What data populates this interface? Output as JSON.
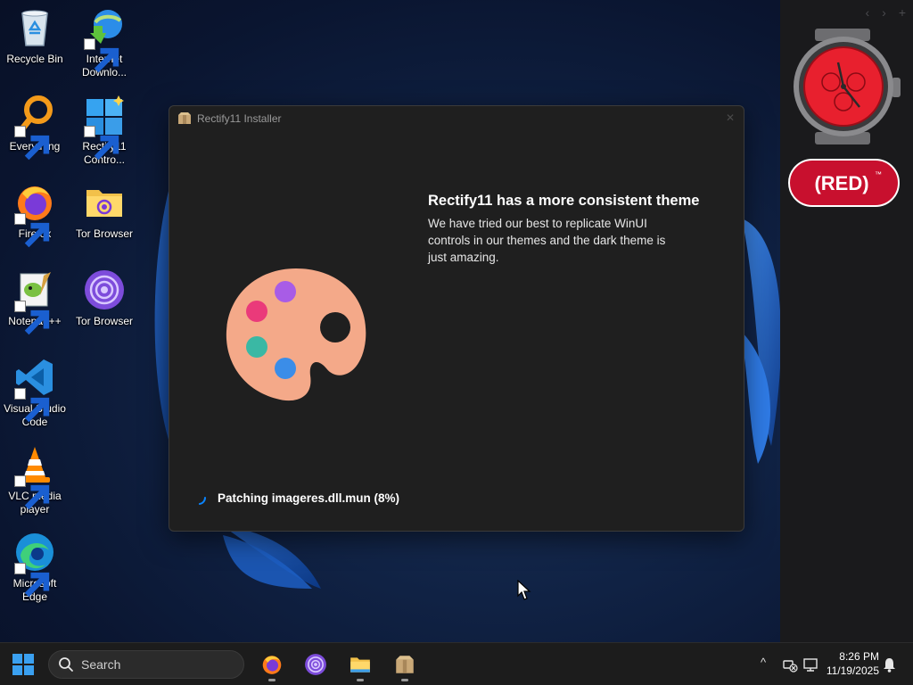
{
  "desktop": {
    "icons": [
      {
        "label": "Recycle Bin"
      },
      {
        "label": "Internet Downlo..."
      },
      {
        "label": "Everything"
      },
      {
        "label": "Rectify11 Contro..."
      },
      {
        "label": "Firefox"
      },
      {
        "label": "Tor Browser"
      },
      {
        "label": "Notepad++"
      },
      {
        "label": "Tor Browser"
      },
      {
        "label": "Visual Studio Code"
      },
      {
        "label": "VLC media player"
      },
      {
        "label": "Microsoft Edge"
      }
    ]
  },
  "side_panel": {
    "nav_back": "‹",
    "nav_forward": "›",
    "nav_add": "+",
    "badge_text": "(RED)",
    "badge_tm": "™"
  },
  "installer": {
    "title": "Rectify11 Installer",
    "close": "✕",
    "heading": "Rectify11 has a more consistent theme",
    "description": "We have tried our best to replicate WinUI controls in our themes and the dark theme is just amazing.",
    "progress_text": "Patching imageres.dll.mun (8%)",
    "progress_percent": 8
  },
  "taskbar": {
    "search_placeholder": "Search",
    "apps": [
      "firefox-icon",
      "tor-browser-icon",
      "file-explorer-icon",
      "installer-icon"
    ],
    "tray_chevron": "^",
    "time": "8:26 PM",
    "date": "11/19/2025"
  },
  "colors": {
    "window_bg": "#1f1f1f",
    "desktop_bg": "#0b1730",
    "accent_blue": "#0a84ff",
    "red_badge": "#c8102e"
  }
}
